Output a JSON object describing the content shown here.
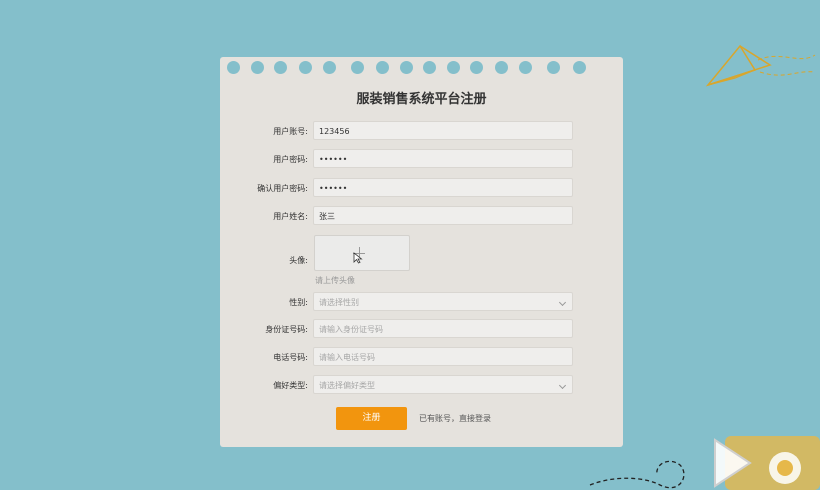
{
  "form": {
    "title": "服装销售系统平台注册",
    "fields": [
      {
        "label": "用户账号:",
        "value": "123456"
      },
      {
        "label": "用户密码:",
        "value": "••••••"
      },
      {
        "label": "确认用户密码:",
        "value": "••••••"
      },
      {
        "label": "用户姓名:",
        "value": "张三"
      },
      {
        "label": "头像:"
      },
      {
        "label": "性别:",
        "placeholder": "请选择性别"
      },
      {
        "label": "身份证号码:",
        "placeholder": "请输入身份证号码"
      },
      {
        "label": "电话号码:",
        "placeholder": "请输入电话号码"
      },
      {
        "label": "偏好类型:",
        "placeholder": "请选择偏好类型"
      }
    ],
    "upload_hint": "请上传头像",
    "submit_label": "注册",
    "login_link": "已有账号，直接登录"
  },
  "colors": {
    "background": "#84bfcb",
    "card": "#e5e2dd",
    "accent": "#f2950e"
  },
  "icons": [
    "paper-plane-icon",
    "plus-icon",
    "chevron-down-icon",
    "mouse-cursor-icon"
  ]
}
